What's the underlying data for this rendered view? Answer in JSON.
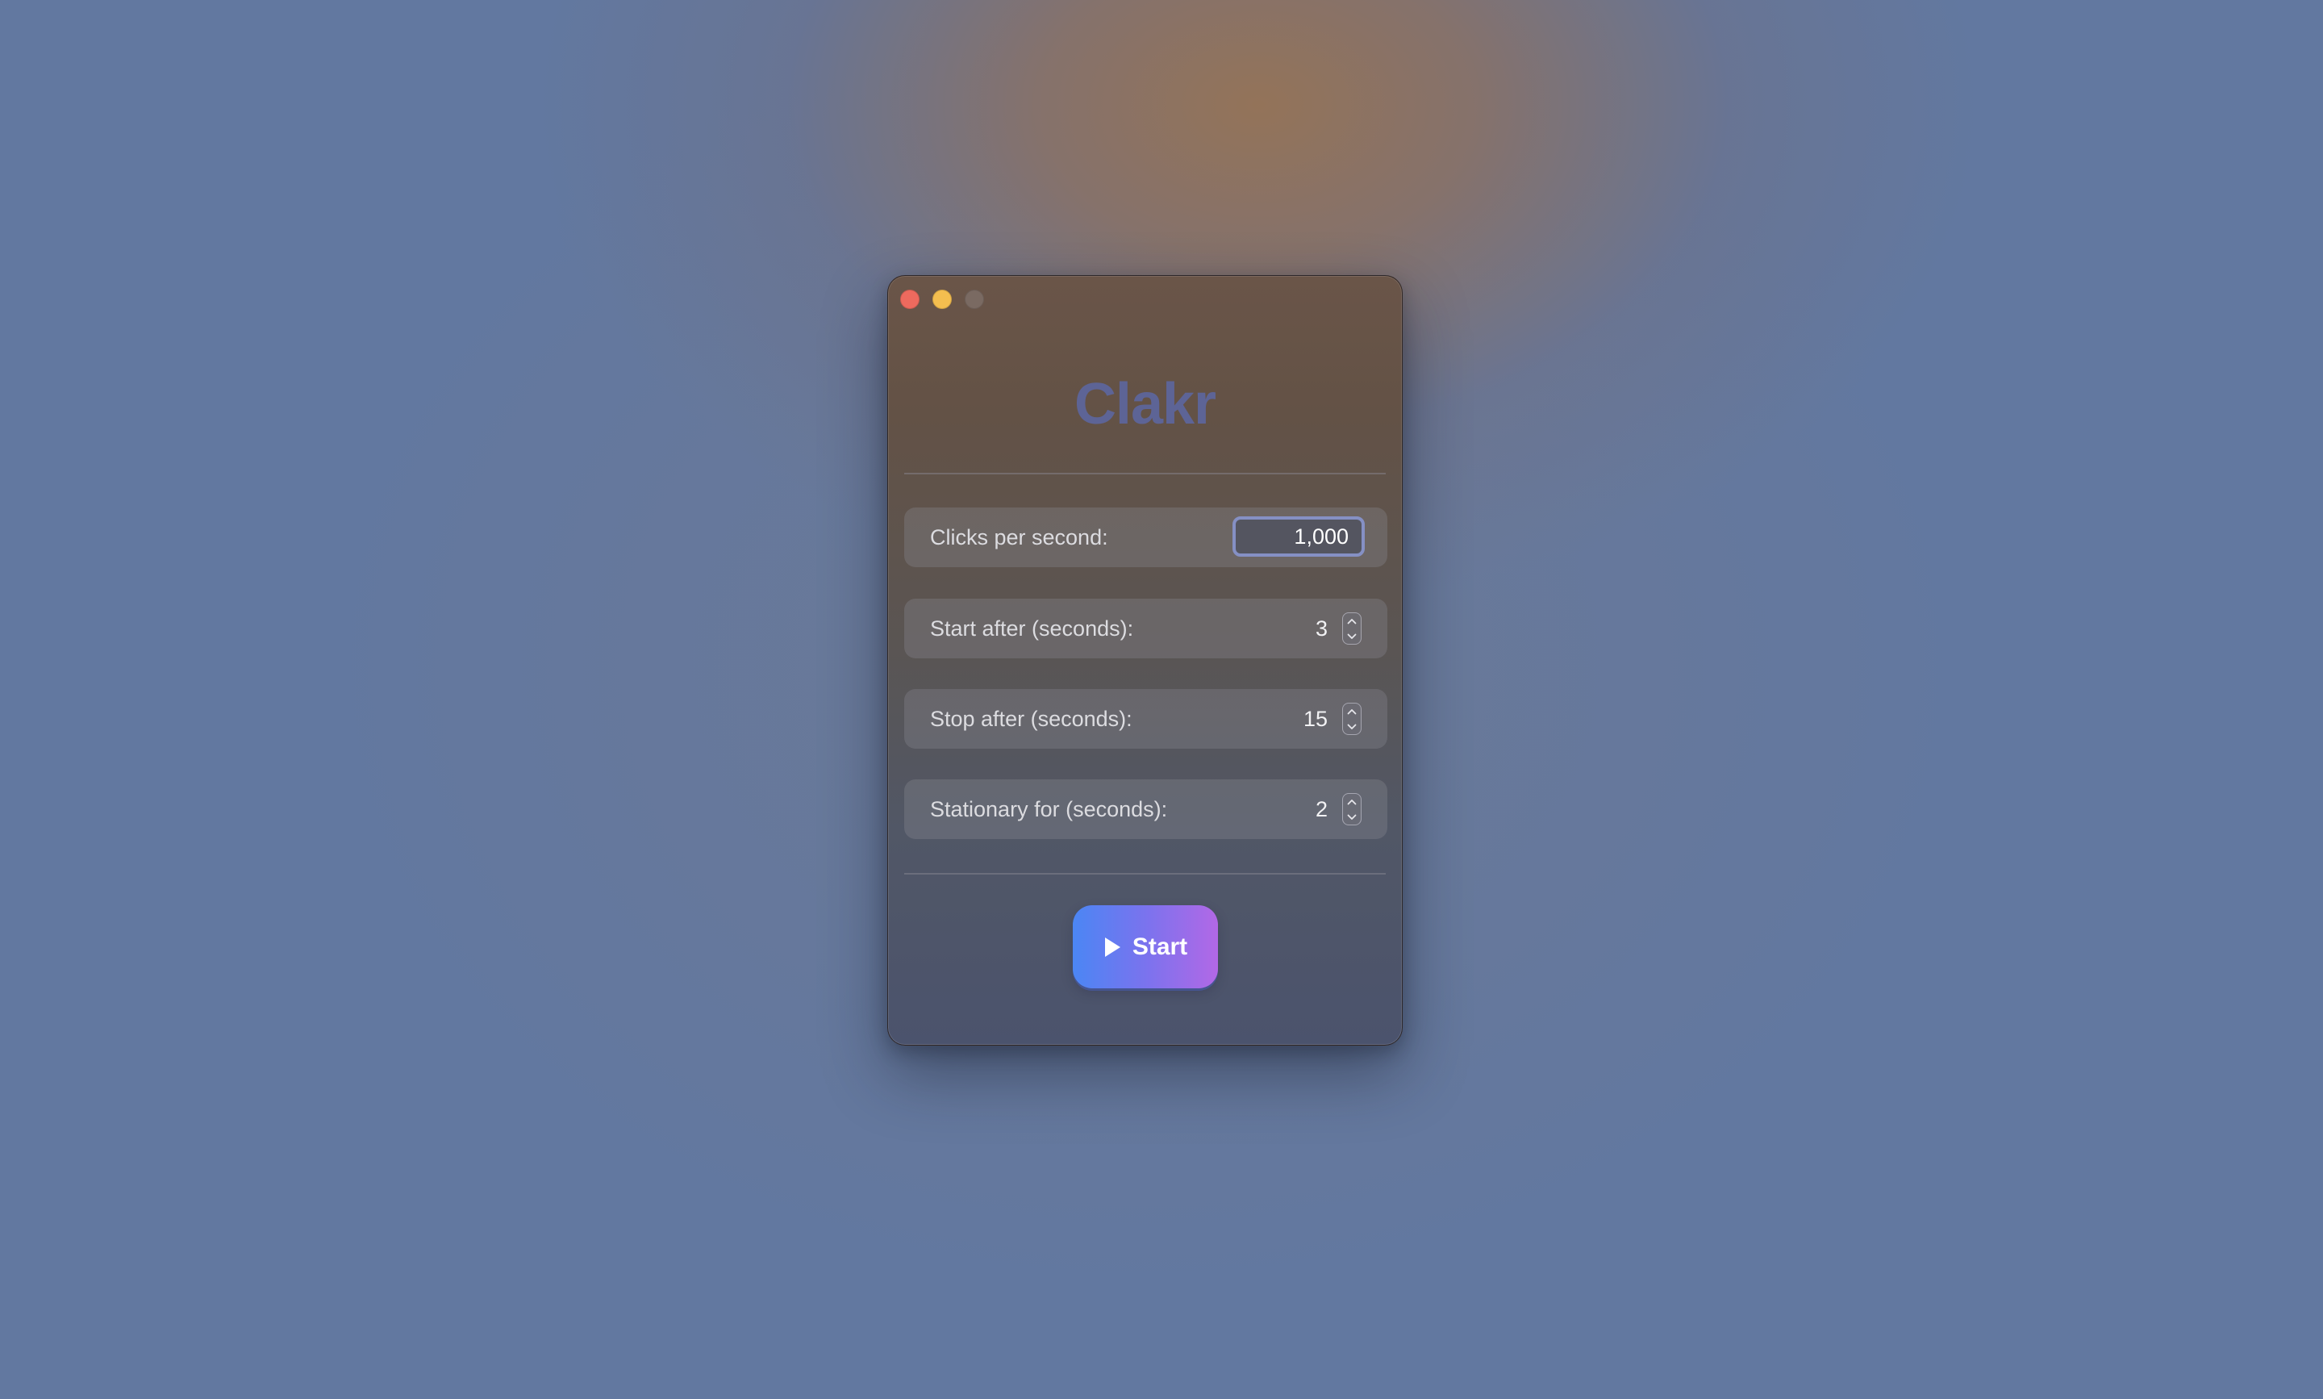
{
  "window": {
    "controls": {
      "close": "close",
      "minimize": "minimize",
      "zoom": "zoom"
    }
  },
  "app": {
    "title": "Clakr"
  },
  "settings": {
    "clicks_per_second": {
      "label": "Clicks per second:",
      "value": "1,000"
    },
    "start_after": {
      "label": "Start after (seconds):",
      "value": "3"
    },
    "stop_after": {
      "label": "Stop after (seconds):",
      "value": "15"
    },
    "stationary_for": {
      "label": "Stationary for (seconds):",
      "value": "2"
    }
  },
  "actions": {
    "start_label": "Start",
    "start_icon": "play-icon"
  },
  "colors": {
    "close": "#ed6a5e",
    "minimize": "#f4be4f",
    "title": "#5d6496",
    "button_gradient_start": "#4b86f4",
    "button_gradient_end": "#b268e6",
    "focus_ring": "#8590c4"
  }
}
